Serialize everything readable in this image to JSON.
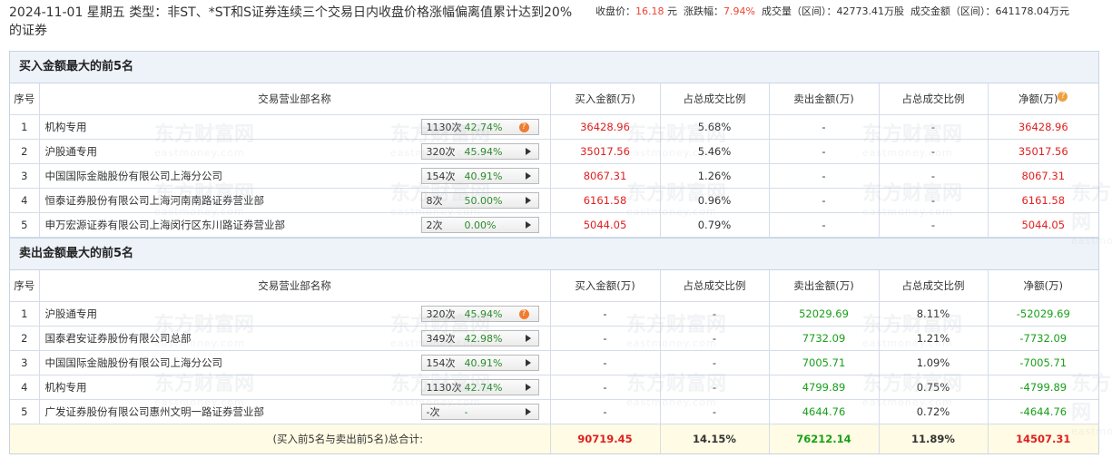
{
  "header": {
    "title": "2024-11-01 星期五 类型：非ST、*ST和S证券连续三个交易日内收盘价格涨幅偏离值累计达到20%的证券",
    "close_label": "收盘价：",
    "close_value": "16.18",
    "close_unit": " 元",
    "change_label": "涨跌幅：",
    "change_value": "7.94%",
    "volume_label": "成交量（区间）：",
    "volume_value": "42773.41万股",
    "amount_label": "成交金额（区间）：",
    "amount_value": "641178.04万元"
  },
  "columns": {
    "seq": "序号",
    "name": "交易营业部名称",
    "buy": "买入金额(万)",
    "buy_ratio": "占总成交比例",
    "sell": "卖出金额(万)",
    "sell_ratio": "占总成交比例",
    "net": "净额(万)"
  },
  "buy_section": {
    "title": "买入金额最大的前5名",
    "rows": [
      {
        "seq": "1",
        "name": "机构专用",
        "count": "1130次",
        "rate": "42.74%",
        "buy": "36428.96",
        "buy_ratio": "5.68%",
        "sell": "-",
        "sell_ratio": "-",
        "net": "36428.96",
        "icon": "question"
      },
      {
        "seq": "2",
        "name": "沪股通专用",
        "count": "320次",
        "rate": "45.94%",
        "buy": "35017.56",
        "buy_ratio": "5.46%",
        "sell": "-",
        "sell_ratio": "-",
        "net": "35017.56",
        "icon": "arrow"
      },
      {
        "seq": "3",
        "name": "中国国际金融股份有限公司上海分公司",
        "count": "154次",
        "rate": "40.91%",
        "buy": "8067.31",
        "buy_ratio": "1.26%",
        "sell": "-",
        "sell_ratio": "-",
        "net": "8067.31",
        "icon": "arrow"
      },
      {
        "seq": "4",
        "name": "恒泰证券股份有限公司上海河南南路证券营业部",
        "count": "8次",
        "rate": "50.00%",
        "buy": "6161.58",
        "buy_ratio": "0.96%",
        "sell": "-",
        "sell_ratio": "-",
        "net": "6161.58",
        "icon": "arrow"
      },
      {
        "seq": "5",
        "name": "申万宏源证券有限公司上海闵行区东川路证券营业部",
        "count": "2次",
        "rate": "0.00%",
        "buy": "5044.05",
        "buy_ratio": "0.79%",
        "sell": "-",
        "sell_ratio": "-",
        "net": "5044.05",
        "icon": "arrow"
      }
    ]
  },
  "sell_section": {
    "title": "卖出金额最大的前5名",
    "rows": [
      {
        "seq": "1",
        "name": "沪股通专用",
        "count": "320次",
        "rate": "45.94%",
        "buy": "-",
        "buy_ratio": "-",
        "sell": "52029.69",
        "sell_ratio": "8.11%",
        "net": "-52029.69",
        "icon": "question"
      },
      {
        "seq": "2",
        "name": "国泰君安证券股份有限公司总部",
        "count": "349次",
        "rate": "42.98%",
        "buy": "-",
        "buy_ratio": "-",
        "sell": "7732.09",
        "sell_ratio": "1.21%",
        "net": "-7732.09",
        "icon": "arrow"
      },
      {
        "seq": "3",
        "name": "中国国际金融股份有限公司上海分公司",
        "count": "154次",
        "rate": "40.91%",
        "buy": "-",
        "buy_ratio": "-",
        "sell": "7005.71",
        "sell_ratio": "1.09%",
        "net": "-7005.71",
        "icon": "arrow"
      },
      {
        "seq": "4",
        "name": "机构专用",
        "count": "1130次",
        "rate": "42.74%",
        "buy": "-",
        "buy_ratio": "-",
        "sell": "4799.89",
        "sell_ratio": "0.75%",
        "net": "-4799.89",
        "icon": "arrow"
      },
      {
        "seq": "5",
        "name": "广发证券股份有限公司惠州文明一路证券营业部",
        "count": "-次",
        "rate": "-",
        "buy": "-",
        "buy_ratio": "-",
        "sell": "4644.76",
        "sell_ratio": "0.72%",
        "net": "-4644.76",
        "icon": "arrow"
      }
    ]
  },
  "total": {
    "label": "(买入前5名与卖出前5名)总合计:",
    "buy": "90719.45",
    "buy_ratio": "14.15%",
    "sell": "76212.14",
    "sell_ratio": "11.89%",
    "net": "14507.31"
  },
  "watermark": {
    "cn": "东方财富网",
    "en": "eastmoney.com"
  }
}
